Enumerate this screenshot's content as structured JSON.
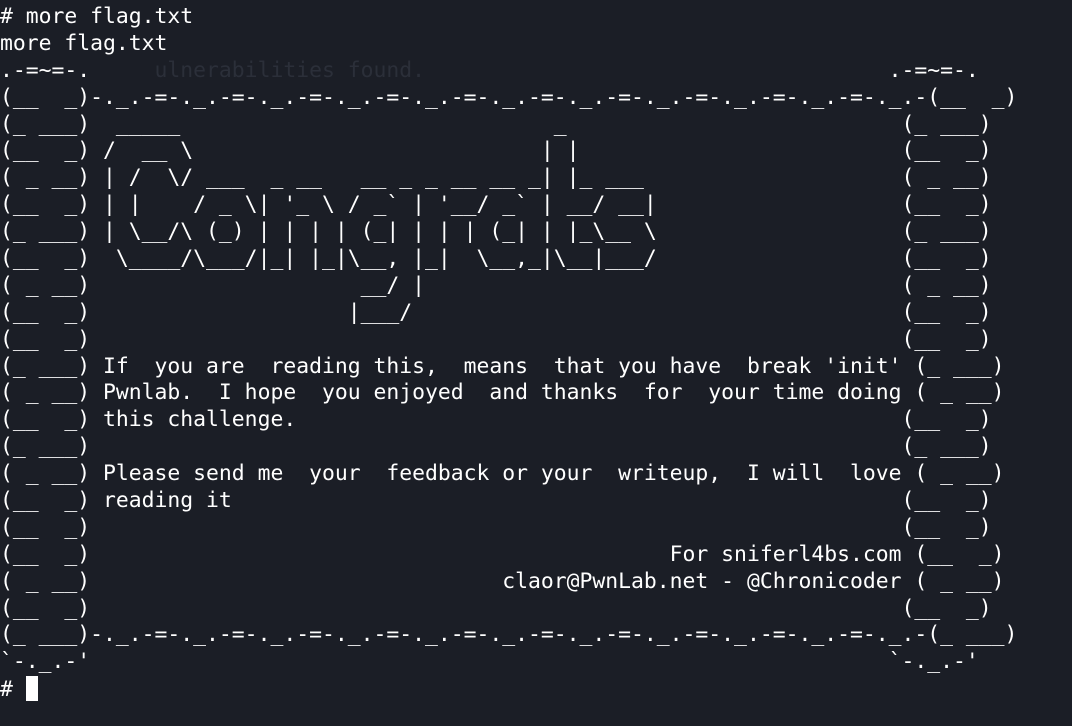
{
  "terminal": {
    "prompt": "# ",
    "ghost_lines": [
      "",
      "",
      "            ulnerabilities found.",
      "",
      "",
      "",
      "",
      "",
      "",
      "",
      "",
      "",
      "",
      "",
      "",
      "",
      "",
      "",
      "",
      "",
      "",
      "",
      "",
      "",
      ""
    ],
    "lines": [
      "# more flag.txt",
      "more flag.txt",
      ".-=~=-.                                                              .-=~=-.",
      "(__  _)-._.-=-._.-=-._.-=-._.-=-._.-=-._.-=-._.-=-._.-=-._.-=-._.-=-._.-(__  _)",
      "(_ ___)  _____                             _                          (_ ___)",
      "(__  _) /  __ \\                           | |                         (__  _)",
      "( _ __) | /  \\/ ___  _ __   __ _ _ __ __ _| |_ ___                    ( _ __)",
      "(__  _) | |    / _ \\| '_ \\ / _` | '__/ _` | __/ __|                   (__  _)",
      "(_ ___) | \\__/\\ (_) | | | | (_| | | | (_| | |_\\__ \\                   (_ ___)",
      "(__  _)  \\____/\\___/|_| |_|\\__, |_|  \\__,_|\\__|___/                   (__  _)",
      "( _ __)                     __/ |                                     ( _ __)",
      "(__  _)                    |___/                                      (__  _)",
      "(__  _)                                                               (__  _)",
      "(_ ___) If  you are  reading this,  means  that you have  break 'init' (_ ___)",
      "( _ __) Pwnlab.  I hope  you enjoyed  and thanks  for  your time doing ( _ __)",
      "(__  _) this challenge.                                               (__  _)",
      "(_ ___)                                                               (_ ___)",
      "( _ __) Please send me  your  feedback or your  writeup,  I will  love ( _ __)",
      "(__  _) reading it                                                    (__  _)",
      "(__  _)                                                               (__  _)",
      "(__  _)                                             For sniferl4bs.com (__  _)",
      "( _ __)                                claor@PwnLab.net - @Chronicoder ( _ __)",
      "(__  _)                                                               (__  _)",
      "(_ ___)-._.-=-._.-=-._.-=-._.-=-._.-=-._.-=-._.-=-._.-=-._.-=-._.-=-._.-(_ ___)",
      "`-._.-'                                                              `-._.-'"
    ]
  }
}
